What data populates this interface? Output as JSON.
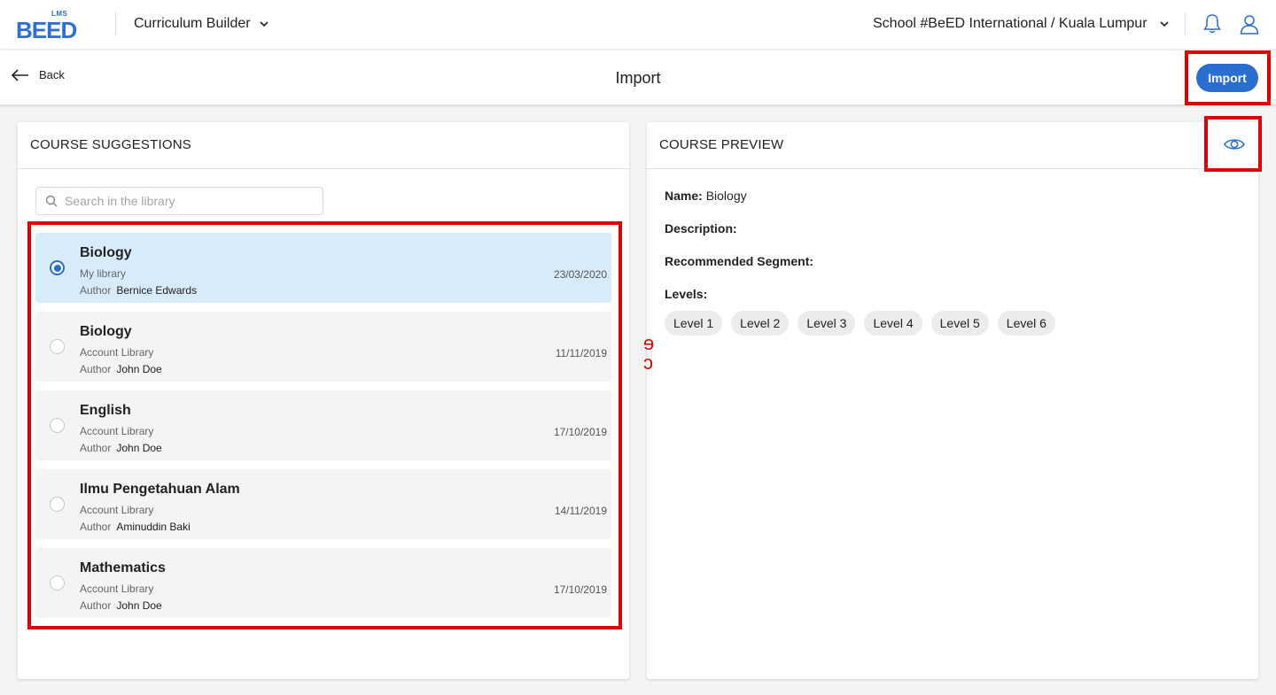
{
  "header": {
    "logo_small": "LMS",
    "logo_word": "BEED",
    "module": "Curriculum Builder",
    "school": "School #BeED International / Kuala Lumpur"
  },
  "subheader": {
    "back_label": "Back",
    "title": "Import",
    "import_label": "Import"
  },
  "suggestions": {
    "title": "COURSE SUGGESTIONS",
    "search_placeholder": "Search in the library",
    "author_label": "Author",
    "courses": [
      {
        "title": "Biology",
        "library": "My library",
        "author": "Bernice Edwards",
        "date": "23/03/2020",
        "selected": true
      },
      {
        "title": "Biology",
        "library": "Account Library",
        "author": "John Doe",
        "date": "11/11/2019",
        "selected": false
      },
      {
        "title": "English",
        "library": "Account Library",
        "author": "John Doe",
        "date": "17/10/2019",
        "selected": false
      },
      {
        "title": "Ilmu Pengetahuan Alam",
        "library": "Account Library",
        "author": "Aminuddin Baki",
        "date": "14/11/2019",
        "selected": false
      },
      {
        "title": "Mathematics",
        "library": "Account Library",
        "author": "John Doe",
        "date": "17/10/2019",
        "selected": false
      }
    ]
  },
  "preview": {
    "title": "COURSE PREVIEW",
    "name_label": "Name:",
    "name_value": "Biology",
    "description_label": "Description:",
    "segment_label": "Recommended Segment:",
    "levels_label": "Levels:",
    "levels": [
      "Level 1",
      "Level 2",
      "Level 3",
      "Level 4",
      "Level 5",
      "Level 6"
    ]
  },
  "stray_mark": "ɘ\nɔ",
  "colors": {
    "accent": "#2a6fcf",
    "selected_bg": "#d8ebfb",
    "highlight": "#e00000"
  }
}
